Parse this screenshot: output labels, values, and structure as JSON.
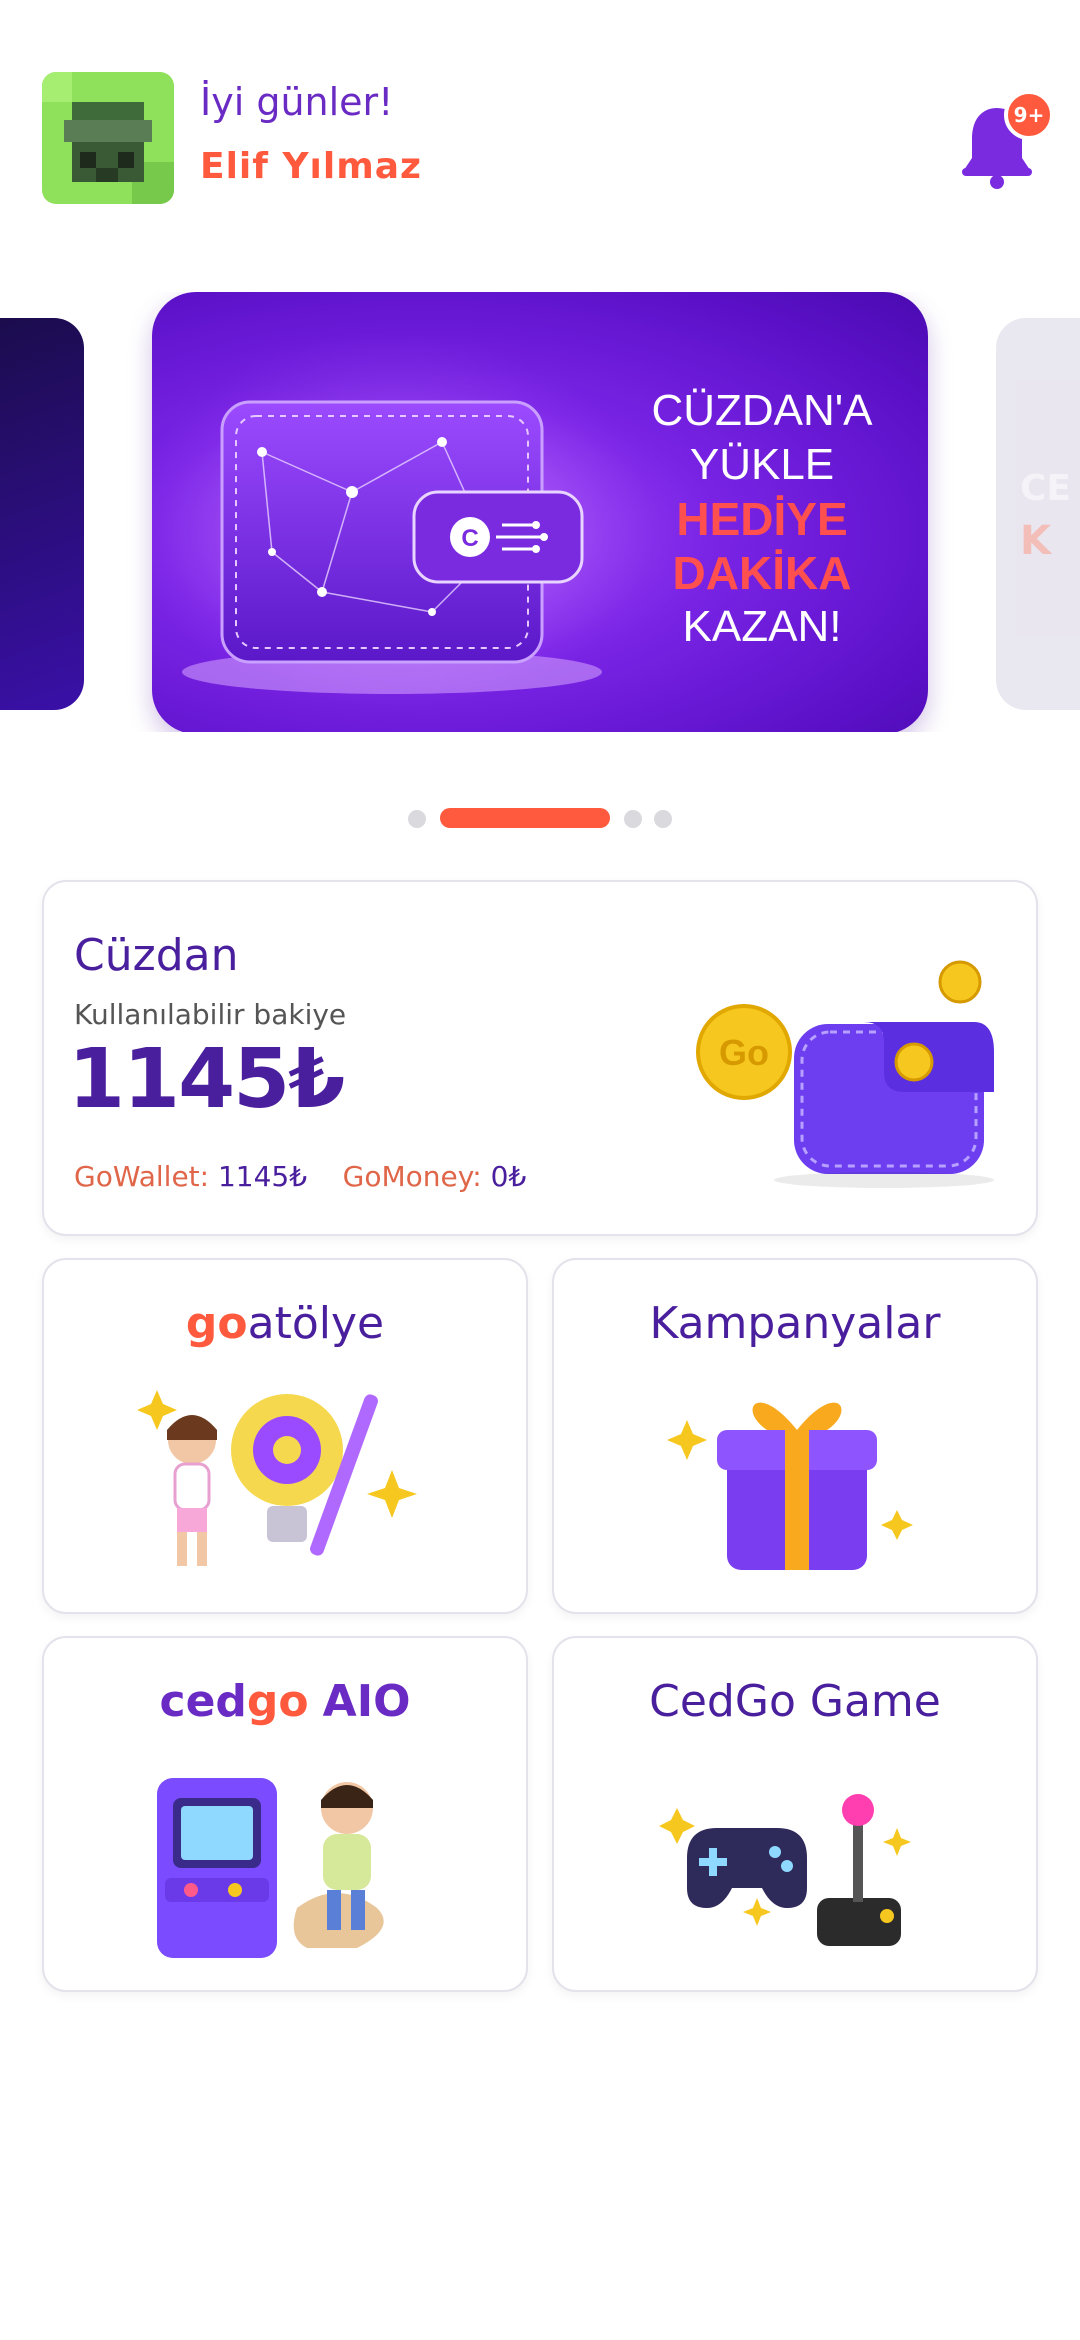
{
  "header": {
    "greeting": "İyi günler!",
    "username": "Elif Yılmaz",
    "notification_badge": "9+"
  },
  "banner": {
    "line1": "CÜZDAN'A",
    "line2": "YÜKLE",
    "line3": "HEDİYE",
    "line4": "DAKİKA",
    "line5": "KAZAN!",
    "next_peek_a": "CE",
    "next_peek_b": "K",
    "active_slide_index": 1,
    "slide_count": 4
  },
  "wallet": {
    "title": "Cüzdan",
    "subtitle": "Kullanılabilir bakiye",
    "amount": "1145₺",
    "gowallet_label": "GoWallet:",
    "gowallet_value": "1145₺",
    "gomoney_label": "GoMoney:",
    "gomoney_value": "0₺",
    "coin_text": "Go"
  },
  "tiles": {
    "atolye": {
      "brand": "go",
      "title": "atölye"
    },
    "kampanyalar": {
      "title": "Kampanyalar"
    },
    "aio": {
      "brand_a": "ced",
      "brand_b": "go",
      "brand_c": "AIO"
    },
    "game": {
      "title": "CedGo Game"
    }
  },
  "colors": {
    "primary": "#4a1f9e",
    "accent": "#ff5a3d",
    "banner": "#6a1ad8"
  }
}
